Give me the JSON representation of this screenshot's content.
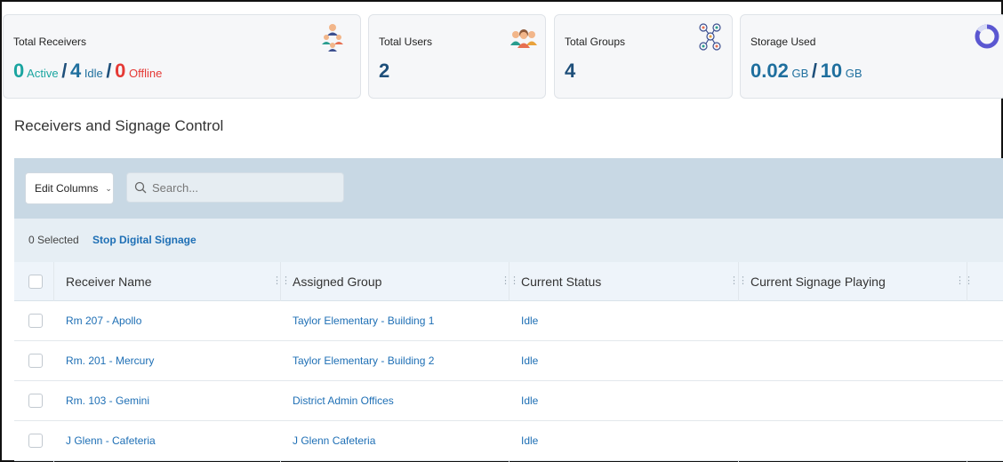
{
  "stats": {
    "receivers": {
      "title": "Total Receivers",
      "active_count": "0",
      "active_label": "Active",
      "sep1": "/",
      "idle_count": "4",
      "idle_label": "Idle",
      "sep2": "/",
      "offline_count": "0",
      "offline_label": "Offline",
      "icon": "receivers-people-icon"
    },
    "users": {
      "title": "Total Users",
      "value": "2",
      "icon": "users-group-icon"
    },
    "groups": {
      "title": "Total Groups",
      "value": "4",
      "icon": "groups-network-icon"
    },
    "storage": {
      "title": "Storage Used",
      "used": "0.02",
      "used_unit": "GB",
      "sep": "/",
      "total": "10",
      "total_unit": "GB",
      "used_fraction": 0.002,
      "icon": "storage-donut-icon"
    }
  },
  "section_title": "Receivers and Signage Control",
  "toolbar": {
    "edit_columns_label": "Edit Columns",
    "search_placeholder": "Search..."
  },
  "selection": {
    "count_label": "0 Selected",
    "stop_label": "Stop Digital Signage"
  },
  "table": {
    "columns": [
      "Receiver Name",
      "Assigned Group",
      "Current Status",
      "Current Signage Playing"
    ],
    "rows": [
      {
        "name": "Rm 207 - Apollo",
        "group": "Taylor Elementary - Building 1",
        "status": "Idle",
        "signage": ""
      },
      {
        "name": "Rm. 201 - Mercury",
        "group": "Taylor Elementary - Building 2",
        "status": "Idle",
        "signage": ""
      },
      {
        "name": "Rm. 103 - Gemini",
        "group": "District Admin Offices",
        "status": "Idle",
        "signage": ""
      },
      {
        "name": "J Glenn - Cafeteria",
        "group": "J Glenn Cafeteria",
        "status": "Idle",
        "signage": ""
      }
    ]
  },
  "colors": {
    "active": "#1aa5a0",
    "idle": "#1f6f9e",
    "offline": "#e53935",
    "link": "#1e6fb5",
    "toolbar_bg": "#c8d8e4"
  }
}
